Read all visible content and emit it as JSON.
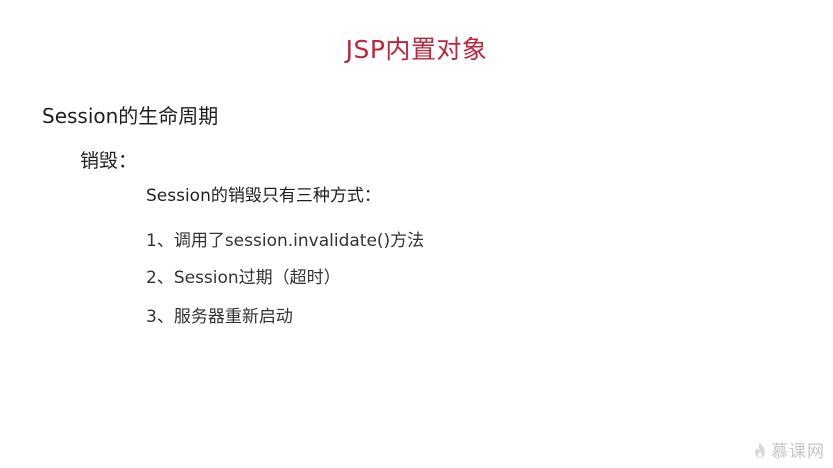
{
  "slide": {
    "title": "JSP内置对象",
    "heading": "Session的生命周期",
    "subheading": "销毁：",
    "intro": "Session的销毁只有三种方式：",
    "items": [
      "1、调用了session.invalidate()方法",
      "2、Session过期（超时）",
      "3、服务器重新启动"
    ]
  },
  "watermark": {
    "text": "慕课网",
    "icon": "flame-logo-icon",
    "color": "#c7c7c7"
  },
  "colors": {
    "title": "#c0243a",
    "text": "#1f1f1f",
    "background": "#ffffff"
  }
}
